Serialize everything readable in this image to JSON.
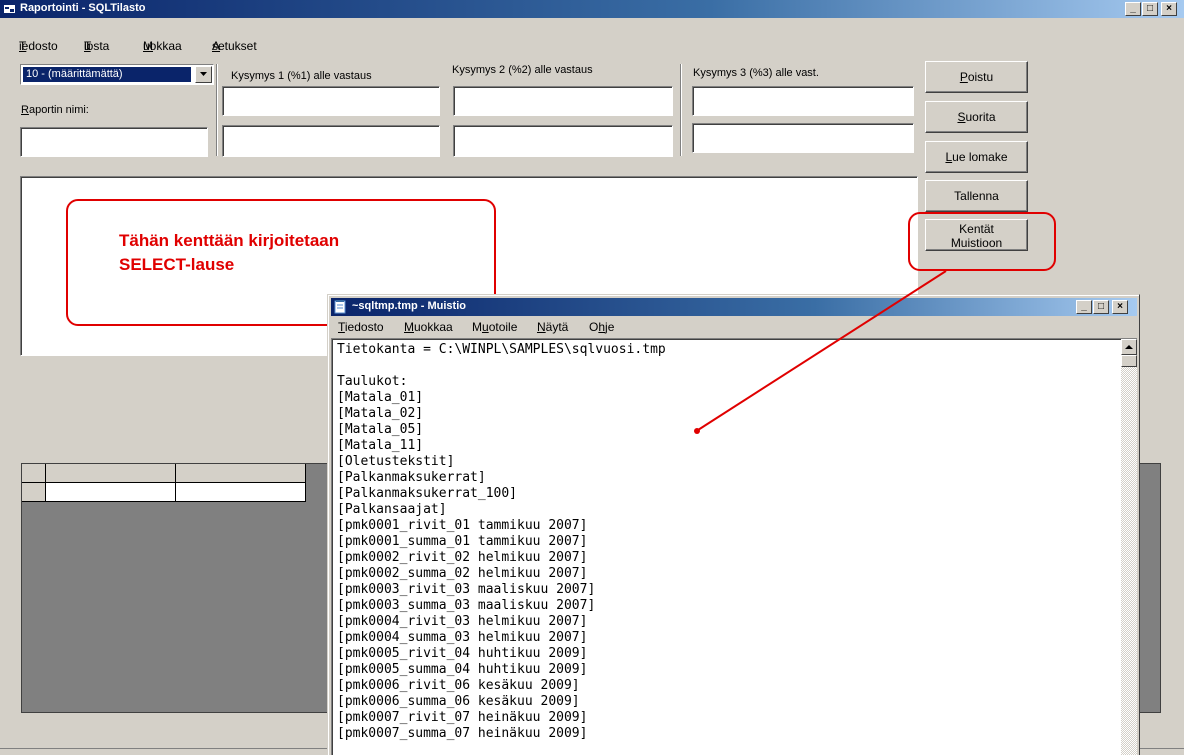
{
  "window": {
    "title": "Raportointi - SQLTilasto"
  },
  "menu": [
    {
      "pre": "",
      "key": "T",
      "post": "iedosto"
    },
    {
      "pre": "T",
      "key": "u",
      "post": "losta"
    },
    {
      "pre": "",
      "key": "M",
      "post": "uokkaa"
    },
    {
      "pre": "",
      "key": "A",
      "post": "setukset"
    }
  ],
  "form": {
    "combo_value": "10 - (määrittämättä)",
    "report_name_label_key": "R",
    "report_name_label_rest": "aportin nimi:",
    "question1_label": "Kysymys 1 (%1) alle vastaus",
    "question2_label": "Kysymys 2 (%2) alle vastaus",
    "question3_label": "Kysymys 3 (%3) alle vast."
  },
  "buttons": {
    "quit_key": "P",
    "quit_rest": "oistu",
    "run_key": "S",
    "run_rest": "uorita",
    "read_key": "L",
    "read_rest": "ue lomake",
    "save": "Tallenna",
    "fields_line1": "Kentät",
    "fields_line2": "Muistioon"
  },
  "annotation": {
    "callout_text": "Tähän kenttään kirjoitetaan\nSELECT-lause"
  },
  "notepad": {
    "title": "~sqltmp.tmp - Muistio",
    "menu": [
      {
        "pre": "",
        "key": "T",
        "post": "iedosto"
      },
      {
        "pre": "",
        "key": "M",
        "post": "uokkaa"
      },
      {
        "pre": "M",
        "key": "u",
        "post": "otoile"
      },
      {
        "pre": "",
        "key": "N",
        "post": "äytä"
      },
      {
        "pre": "O",
        "key": "h",
        "post": "je"
      }
    ],
    "lines": [
      "Tietokanta = C:\\WINPL\\SAMPLES\\sqlvuosi.tmp",
      "",
      "Taulukot:",
      "[Matala_01]",
      "[Matala_02]",
      "[Matala_05]",
      "[Matala_11]",
      "[Oletustekstit]",
      "[Palkanmaksukerrat]",
      "[Palkanmaksukerrat_100]",
      "[Palkansaajat]",
      "[pmk0001_rivit_01 tammikuu 2007]",
      "[pmk0001_summa_01 tammikuu 2007]",
      "[pmk0002_rivit_02 helmikuu 2007]",
      "[pmk0002_summa_02 helmikuu 2007]",
      "[pmk0003_rivit_03 maaliskuu 2007]",
      "[pmk0003_summa_03 maaliskuu 2007]",
      "[pmk0004_rivit_03 helmikuu 2007]",
      "[pmk0004_summa_03 helmikuu 2007]",
      "[pmk0005_rivit_04 huhtikuu 2009]",
      "[pmk0005_summa_04 huhtikuu 2009]",
      "[pmk0006_rivit_06 kesäkuu 2009]",
      "[pmk0006_summa_06 kesäkuu 2009]",
      "[pmk0007_rivit_07 heinäkuu 2009]",
      "[pmk0007_summa_07 heinäkuu 2009]"
    ]
  },
  "colors": {
    "titlebar": "#0a246a",
    "annotation": "#e00000",
    "face": "#d4d0c8"
  }
}
